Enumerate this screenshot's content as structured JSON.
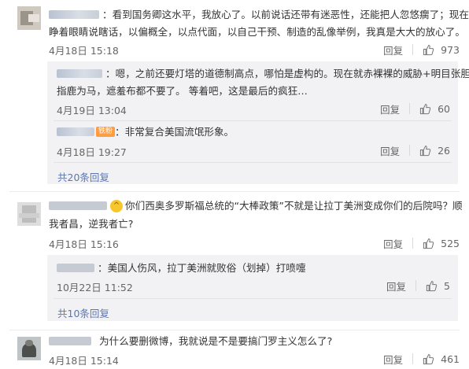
{
  "comments": [
    {
      "text_line1": "：看到国务卿这水平，我放心了。以前说话还带有迷恶性，还能把人忽悠瘸了；现在直接",
      "text_line2": "睁着眼睛说瞎话，以偏概全，以点代面，以自己干预、制造的乱像举例，我真是大大的放心了。",
      "date": "4月18日 15:18",
      "reply_label": "回复",
      "likes": "973",
      "replies": [
        {
          "text_line1": "：嗯，之前还要灯塔的道德制高点，哪怕是虚构的。现在就赤裸裸的威胁+明目张胆的",
          "text_line2": "指鹿为马，遮羞布都不要了。 等着吧，这是最后的疯狂…",
          "date": "4月19日 13:04",
          "reply_label": "回复",
          "likes": "60"
        },
        {
          "badge": "铁粉",
          "text_line1": "：非常复合美国流氓形象。",
          "date": "4月18日 19:27",
          "reply_label": "回复",
          "likes": "26"
        }
      ],
      "more_replies": "共20条回复"
    },
    {
      "emoji": "icon-cat",
      "text_line1": "你们西奥多罗斯福总统的“大棒政策”不就是让拉丁美洲变成你们的后院吗？顺",
      "text_line2": "我者昌，逆我者亡?",
      "date": "4月18日 15:16",
      "reply_label": "回复",
      "likes": "525",
      "replies": [
        {
          "text_line1": "：美国人伤风，拉丁美洲就败俗（划掉）打喷嚏",
          "date": "10月22日 11:52",
          "reply_label": "回复",
          "likes": "5"
        }
      ],
      "more_replies": "共10条回复"
    },
    {
      "text_line1": "为什么要删微博，我就说是不是要搞门罗主义怎么了?",
      "date": "4月18日 15:14",
      "reply_label": "回复",
      "likes": "461"
    }
  ],
  "colors": {
    "link": "#5a76b3",
    "reply_bg": "#f2f2f5",
    "badge": "#ff9d42"
  }
}
